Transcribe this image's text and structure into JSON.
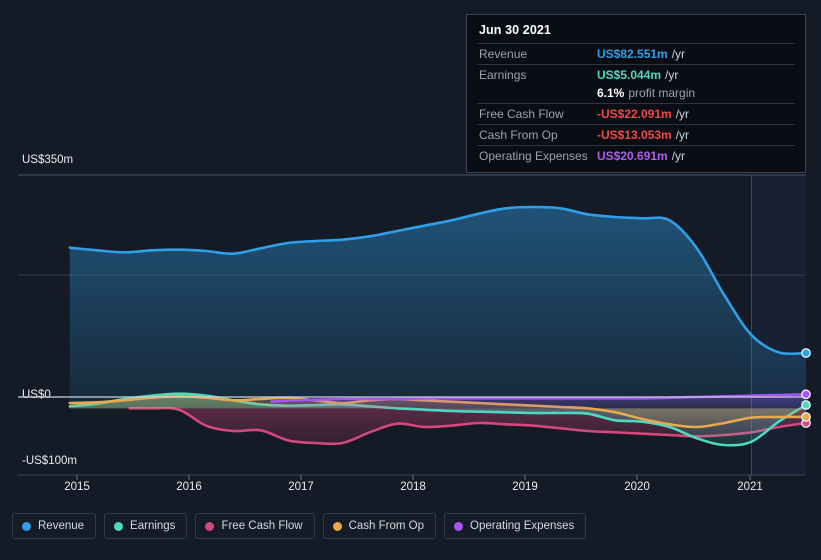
{
  "tooltip": {
    "date": "Jun 30 2021",
    "rows": [
      {
        "label": "Revenue",
        "value": "US$82.551m",
        "suffix": "/yr",
        "color": "#2f9fe8"
      },
      {
        "label": "Earnings",
        "value": "US$5.044m",
        "suffix": "/yr",
        "color": "#4fd8c0"
      },
      {
        "label": "",
        "value": "6.1%",
        "suffix": "profit margin",
        "color": "#ffffff",
        "margin_row": true
      },
      {
        "label": "Free Cash Flow",
        "value": "-US$22.091m",
        "suffix": "/yr",
        "color": "#f04a4a"
      },
      {
        "label": "Cash From Op",
        "value": "-US$13.053m",
        "suffix": "/yr",
        "color": "#f04a4a"
      },
      {
        "label": "Operating Expenses",
        "value": "US$20.691m",
        "suffix": "/yr",
        "color": "#b05cf0"
      }
    ]
  },
  "legend": [
    {
      "label": "Revenue",
      "color": "#2f9fe8"
    },
    {
      "label": "Earnings",
      "color": "#4fd8c0"
    },
    {
      "label": "Free Cash Flow",
      "color": "#d6467f"
    },
    {
      "label": "Cash From Op",
      "color": "#e8a84c"
    },
    {
      "label": "Operating Expenses",
      "color": "#a855f7"
    }
  ],
  "axis": {
    "y_top_label": "US$350m",
    "y_zero_label": "US$0",
    "y_bottom_label": "-US$100m",
    "x_labels": [
      "2015",
      "2016",
      "2017",
      "2018",
      "2019",
      "2020",
      "2021"
    ]
  },
  "chart_data": {
    "type": "area",
    "title": "",
    "xlabel": "",
    "ylabel": "US$m",
    "ylim": [
      -100,
      350
    ],
    "yticks": [
      350,
      175,
      0,
      -100
    ],
    "xlim": [
      2014.55,
      2021.5
    ],
    "xticks": [
      2015,
      2016,
      2017,
      2018,
      2019,
      2020,
      2021
    ],
    "grid": true,
    "legend_position": "bottom",
    "forecast_region": [
      2021.0,
      2021.5
    ],
    "annotation": "Jun 30 2021 tooltip shown",
    "series": [
      {
        "name": "Revenue",
        "color": "#2f9fe8",
        "x": [
          2014.75,
          2015.0,
          2015.25,
          2015.5,
          2015.75,
          2016.0,
          2016.25,
          2016.5,
          2016.75,
          2017.0,
          2017.25,
          2017.5,
          2017.75,
          2018.0,
          2018.25,
          2018.5,
          2018.75,
          2019.0,
          2019.25,
          2019.5,
          2019.75,
          2020.0,
          2020.25,
          2020.5,
          2020.75,
          2021.0,
          2021.25,
          2021.5
        ],
        "values": [
          241,
          237,
          234,
          237,
          238,
          236,
          232,
          240,
          248,
          251,
          253,
          258,
          266,
          274,
          282,
          292,
          300,
          302,
          300,
          291,
          287,
          285,
          282,
          240,
          170,
          110,
          84,
          83
        ]
      },
      {
        "name": "Earnings",
        "color": "#4fd8c0",
        "x": [
          2014.75,
          2015.0,
          2015.25,
          2015.5,
          2015.75,
          2016.0,
          2016.25,
          2016.5,
          2016.75,
          2017.0,
          2017.25,
          2017.5,
          2017.75,
          2018.0,
          2018.25,
          2018.5,
          2018.75,
          2019.0,
          2019.25,
          2019.5,
          2019.75,
          2020.0,
          2020.25,
          2020.5,
          2020.75,
          2021.0,
          2021.25,
          2021.5
        ],
        "values": [
          3,
          7,
          14,
          19,
          22,
          19,
          12,
          6,
          4,
          5,
          6,
          3,
          0,
          -2,
          -4,
          -5,
          -6,
          -7,
          -7,
          -8,
          -18,
          -20,
          -28,
          -45,
          -55,
          -50,
          -20,
          5
        ]
      },
      {
        "name": "Free Cash Flow",
        "color": "#d6467f",
        "x": [
          2015.3,
          2015.5,
          2015.75,
          2016.0,
          2016.25,
          2016.5,
          2016.75,
          2017.0,
          2017.25,
          2017.5,
          2017.75,
          2018.0,
          2018.25,
          2018.5,
          2018.75,
          2019.0,
          2019.25,
          2019.5,
          2019.75,
          2020.0,
          2020.25,
          2020.5,
          2020.75,
          2021.0,
          2021.25,
          2021.5
        ],
        "values": [
          0,
          0,
          -2,
          -26,
          -34,
          -33,
          -48,
          -52,
          -52,
          -36,
          -23,
          -28,
          -26,
          -22,
          -24,
          -26,
          -30,
          -34,
          -36,
          -38,
          -40,
          -42,
          -40,
          -36,
          -28,
          -22
        ]
      },
      {
        "name": "Cash From Op",
        "color": "#e8a84c",
        "x": [
          2014.75,
          2015.0,
          2015.25,
          2015.5,
          2015.75,
          2016.0,
          2016.25,
          2016.5,
          2016.75,
          2017.0,
          2017.25,
          2017.5,
          2017.75,
          2018.0,
          2018.25,
          2018.5,
          2018.75,
          2019.0,
          2019.25,
          2019.5,
          2019.75,
          2020.0,
          2020.25,
          2020.5,
          2020.75,
          2021.0,
          2021.25,
          2021.5
        ],
        "values": [
          8,
          9,
          12,
          16,
          18,
          16,
          12,
          14,
          16,
          12,
          8,
          12,
          14,
          12,
          10,
          8,
          6,
          4,
          2,
          0,
          -6,
          -16,
          -24,
          -28,
          -22,
          -14,
          -13,
          -13
        ]
      },
      {
        "name": "Operating Expenses",
        "color": "#a855f7",
        "x": [
          2016.6,
          2016.8,
          2017.0,
          2017.25,
          2017.5,
          2017.75,
          2018.0,
          2018.25,
          2018.5,
          2018.75,
          2019.0,
          2019.25,
          2019.5,
          2019.75,
          2020.0,
          2020.25,
          2020.5,
          2020.75,
          2021.0,
          2021.25,
          2021.5
        ],
        "values": [
          10,
          12,
          13,
          14,
          14,
          14,
          15,
          15,
          15,
          15,
          15,
          15,
          15,
          15,
          15,
          16,
          17,
          18,
          19,
          20,
          21
        ]
      }
    ]
  }
}
